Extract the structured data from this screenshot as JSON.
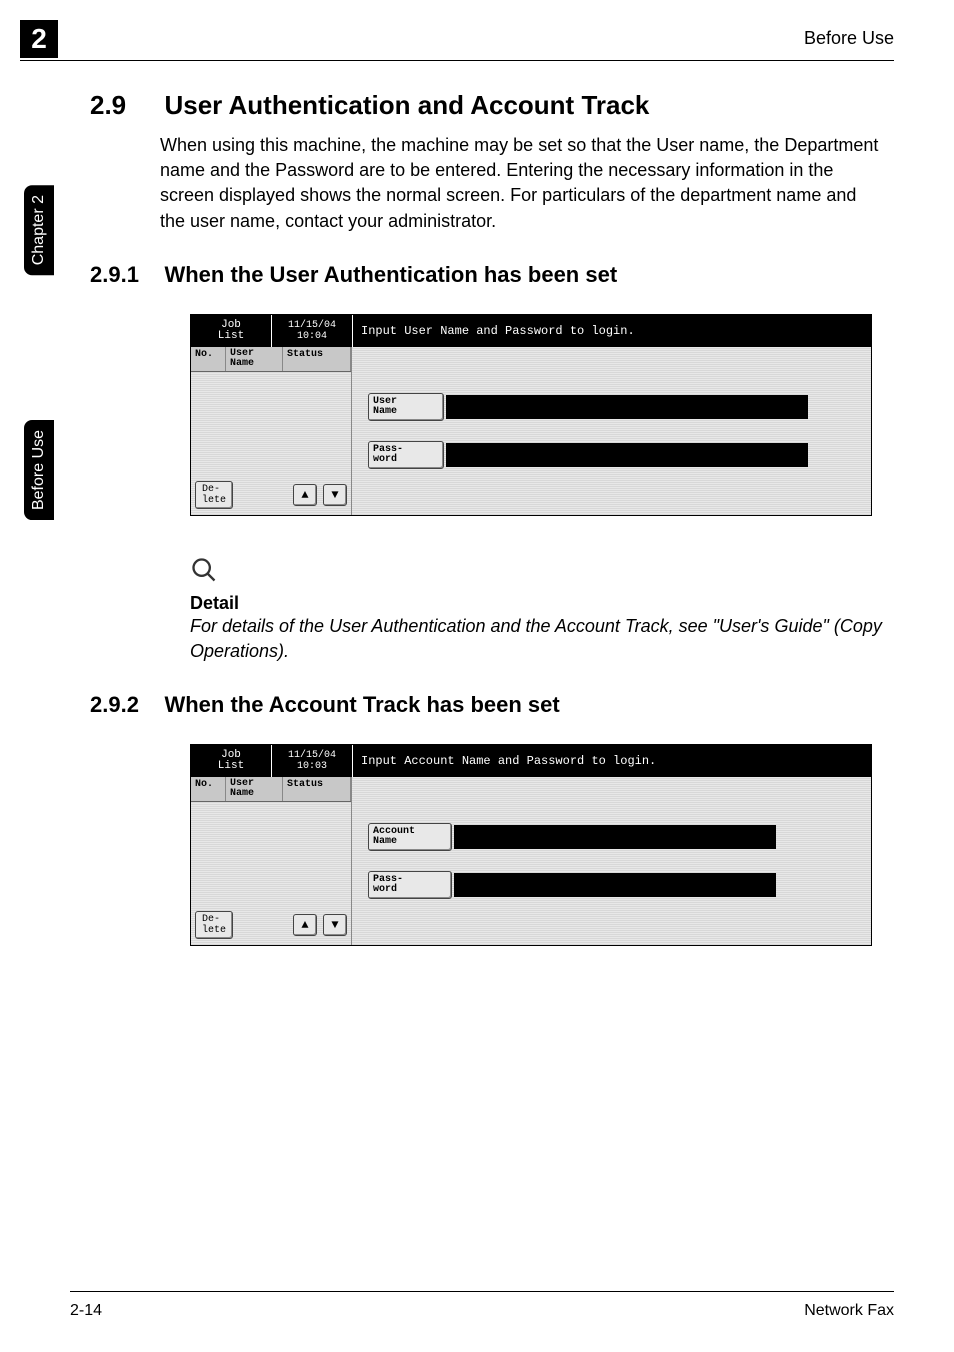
{
  "page_badge": "2",
  "header_right": "Before Use",
  "side_tabs": {
    "chapter": "Chapter 2",
    "section": "Before Use"
  },
  "section_2_9": {
    "number": "2.9",
    "title": "User Authentication and Account Track",
    "body": "When using this machine, the machine may be set so that the User name, the Department name and the Password are to be entered. Entering the necessary information in the screen displayed shows the normal screen. For particulars of the department name and the user name, contact your administrator."
  },
  "section_2_9_1": {
    "number": "2.9.1",
    "title": "When the User Authentication has been set",
    "lcd": {
      "tab": "Job\nList",
      "date": "11/15/04",
      "time": "10:04",
      "message": "Input User Name and Password to login.",
      "left_headers": {
        "no": "No.",
        "user": "User\nName",
        "status": "Status"
      },
      "left_delete": "De-\nlete",
      "field1": "User\nName",
      "field2": "Pass-\nword"
    }
  },
  "detail": {
    "heading": "Detail",
    "text": "For details of the User Authentication and the Account Track, see \"User's Guide\" (Copy Operations)."
  },
  "section_2_9_2": {
    "number": "2.9.2",
    "title": "When the Account Track has been set",
    "lcd": {
      "tab": "Job\nList",
      "date": "11/15/04",
      "time": "10:03",
      "message": "Input Account Name and Password to login.",
      "left_headers": {
        "no": "No.",
        "user": "User\nName",
        "status": "Status"
      },
      "left_delete": "De-\nlete",
      "field1": "Account\nName",
      "field2": "Pass-\nword"
    }
  },
  "footer": {
    "left": "2-14",
    "right": "Network Fax"
  }
}
